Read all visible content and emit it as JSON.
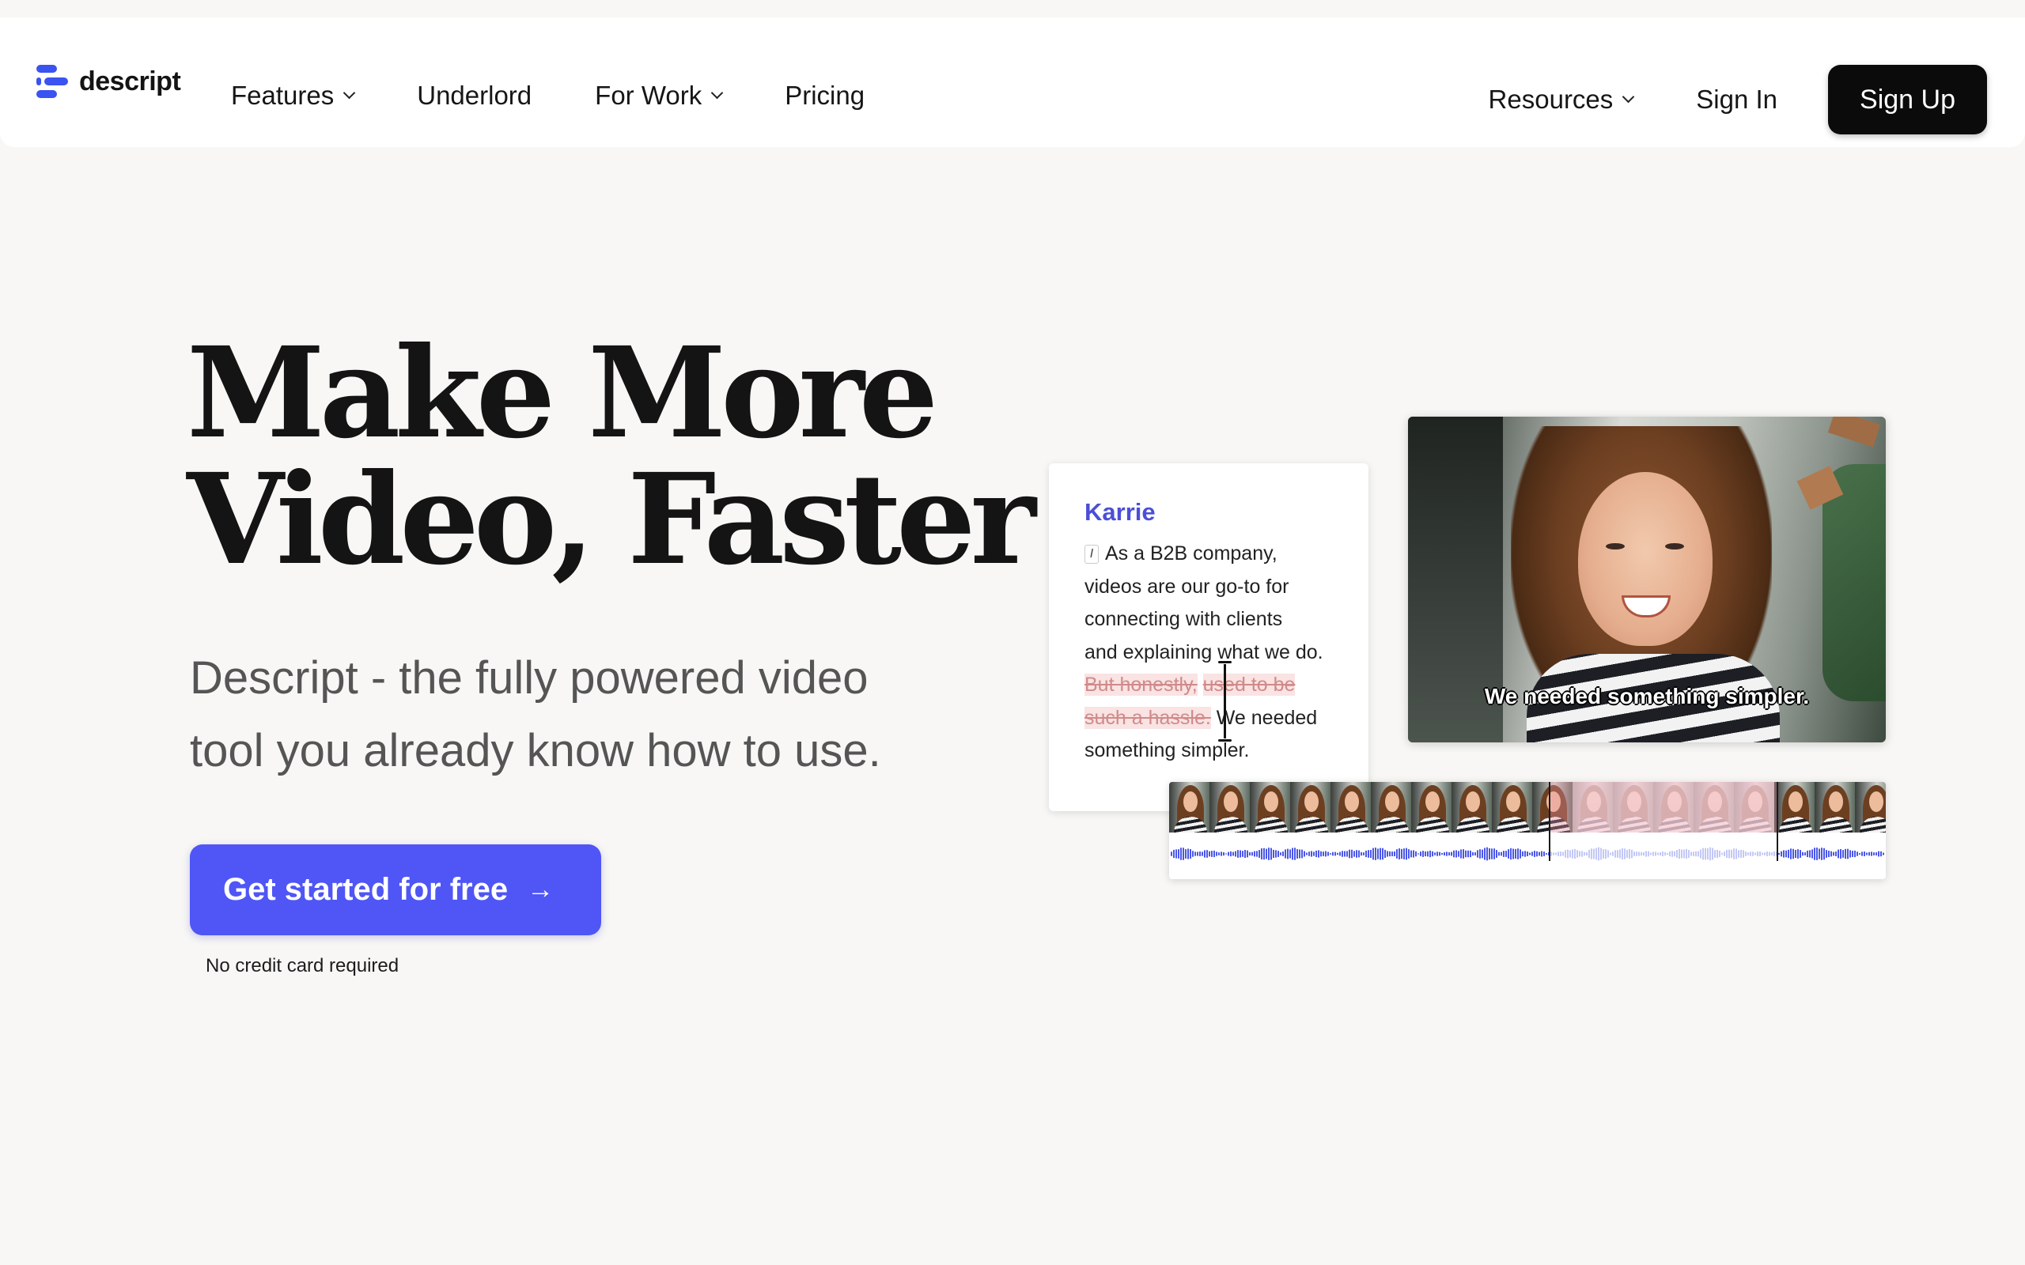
{
  "nav": {
    "logo_text": "descript",
    "links": {
      "features": "Features",
      "underlord": "Underlord",
      "for_work": "For Work",
      "pricing": "Pricing",
      "resources": "Resources"
    },
    "sign_in": "Sign In",
    "sign_up": "Sign Up"
  },
  "hero": {
    "title_line1": "Make More",
    "title_line2": "Video, Faster",
    "subtitle_line1": "Descript - the fully powered video",
    "subtitle_line2": "tool you already know how to use.",
    "cta_label": "Get started for free",
    "cta_note": "No credit card required"
  },
  "transcript": {
    "speaker": "Karrie",
    "cursor_marker": "I",
    "line1": "As a B2B company,",
    "line2": "videos are our go-to for",
    "line3": "connecting with clients",
    "line4": "and explaining what we do.",
    "struck1a": "But honestly,",
    "struck1b": "used to be",
    "struck2": "such a hassle.",
    "after_struck": "We needed",
    "line7": "something simpler."
  },
  "video": {
    "caption": "We needed something simpler."
  },
  "colors": {
    "accent": "#4f56f5",
    "speaker": "#4b4fd6",
    "background": "#f8f7f5",
    "waveform": "#4a57e8"
  }
}
